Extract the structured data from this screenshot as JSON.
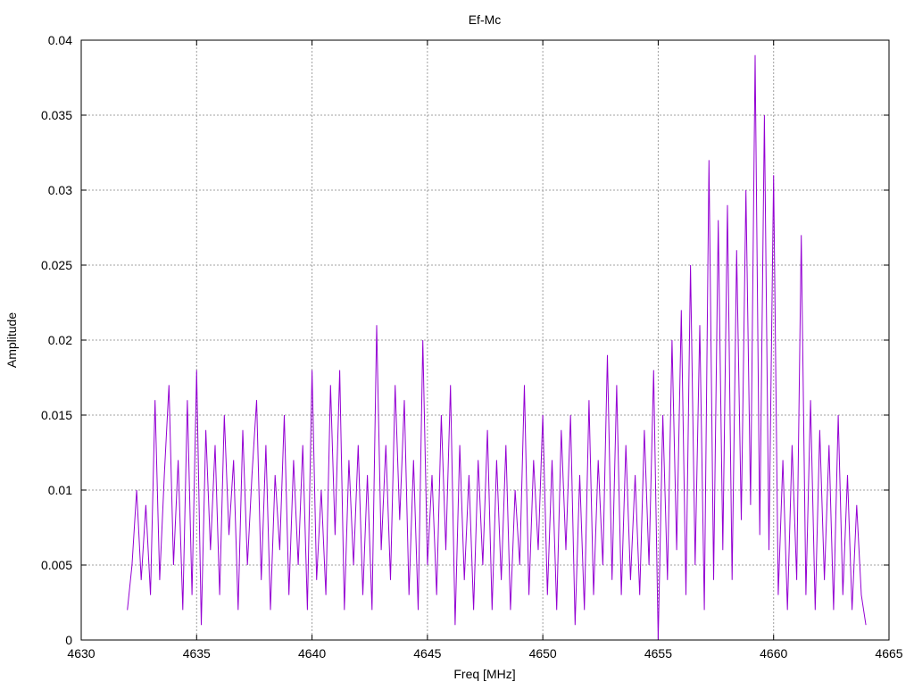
{
  "chart_data": {
    "type": "line",
    "title": "Ef-Mc",
    "xlabel": "Freq [MHz]",
    "ylabel": "Amplitude",
    "xlim": [
      4630,
      4665
    ],
    "ylim": [
      0,
      0.04
    ],
    "xticks": [
      "4630",
      "4635",
      "4640",
      "4645",
      "4650",
      "4655",
      "4660",
      "4665"
    ],
    "yticks": [
      "0",
      "0.005",
      "0.01",
      "0.015",
      "0.02",
      "0.025",
      "0.03",
      "0.035",
      "0.04"
    ],
    "grid": true,
    "legend": "none",
    "series": [
      {
        "name": "Ef-Mc",
        "color": "#9400d3",
        "x_start": 4632.0,
        "x_step": 0.2,
        "values": [
          0.002,
          0.005,
          0.01,
          0.004,
          0.009,
          0.003,
          0.016,
          0.004,
          0.011,
          0.017,
          0.005,
          0.012,
          0.002,
          0.016,
          0.003,
          0.018,
          0.001,
          0.014,
          0.006,
          0.013,
          0.003,
          0.015,
          0.007,
          0.012,
          0.002,
          0.014,
          0.005,
          0.011,
          0.016,
          0.004,
          0.013,
          0.002,
          0.011,
          0.006,
          0.015,
          0.003,
          0.012,
          0.005,
          0.013,
          0.002,
          0.018,
          0.004,
          0.01,
          0.003,
          0.017,
          0.007,
          0.018,
          0.002,
          0.012,
          0.005,
          0.013,
          0.003,
          0.011,
          0.002,
          0.021,
          0.006,
          0.013,
          0.004,
          0.017,
          0.008,
          0.016,
          0.003,
          0.012,
          0.002,
          0.02,
          0.005,
          0.011,
          0.003,
          0.015,
          0.006,
          0.017,
          0.001,
          0.013,
          0.004,
          0.011,
          0.002,
          0.012,
          0.005,
          0.014,
          0.002,
          0.012,
          0.004,
          0.013,
          0.002,
          0.01,
          0.005,
          0.017,
          0.003,
          0.012,
          0.006,
          0.015,
          0.003,
          0.012,
          0.002,
          0.014,
          0.006,
          0.015,
          0.001,
          0.011,
          0.002,
          0.016,
          0.003,
          0.012,
          0.005,
          0.019,
          0.004,
          0.017,
          0.003,
          0.013,
          0.004,
          0.011,
          0.003,
          0.014,
          0.005,
          0.018,
          0.0,
          0.015,
          0.004,
          0.02,
          0.006,
          0.022,
          0.003,
          0.025,
          0.005,
          0.021,
          0.002,
          0.032,
          0.004,
          0.028,
          0.006,
          0.029,
          0.004,
          0.026,
          0.008,
          0.03,
          0.009,
          0.039,
          0.007,
          0.035,
          0.006,
          0.031,
          0.003,
          0.012,
          0.002,
          0.013,
          0.004,
          0.027,
          0.003,
          0.016,
          0.002,
          0.014,
          0.004,
          0.013,
          0.002,
          0.015,
          0.003,
          0.011,
          0.002,
          0.009,
          0.003,
          0.001
        ]
      }
    ]
  }
}
